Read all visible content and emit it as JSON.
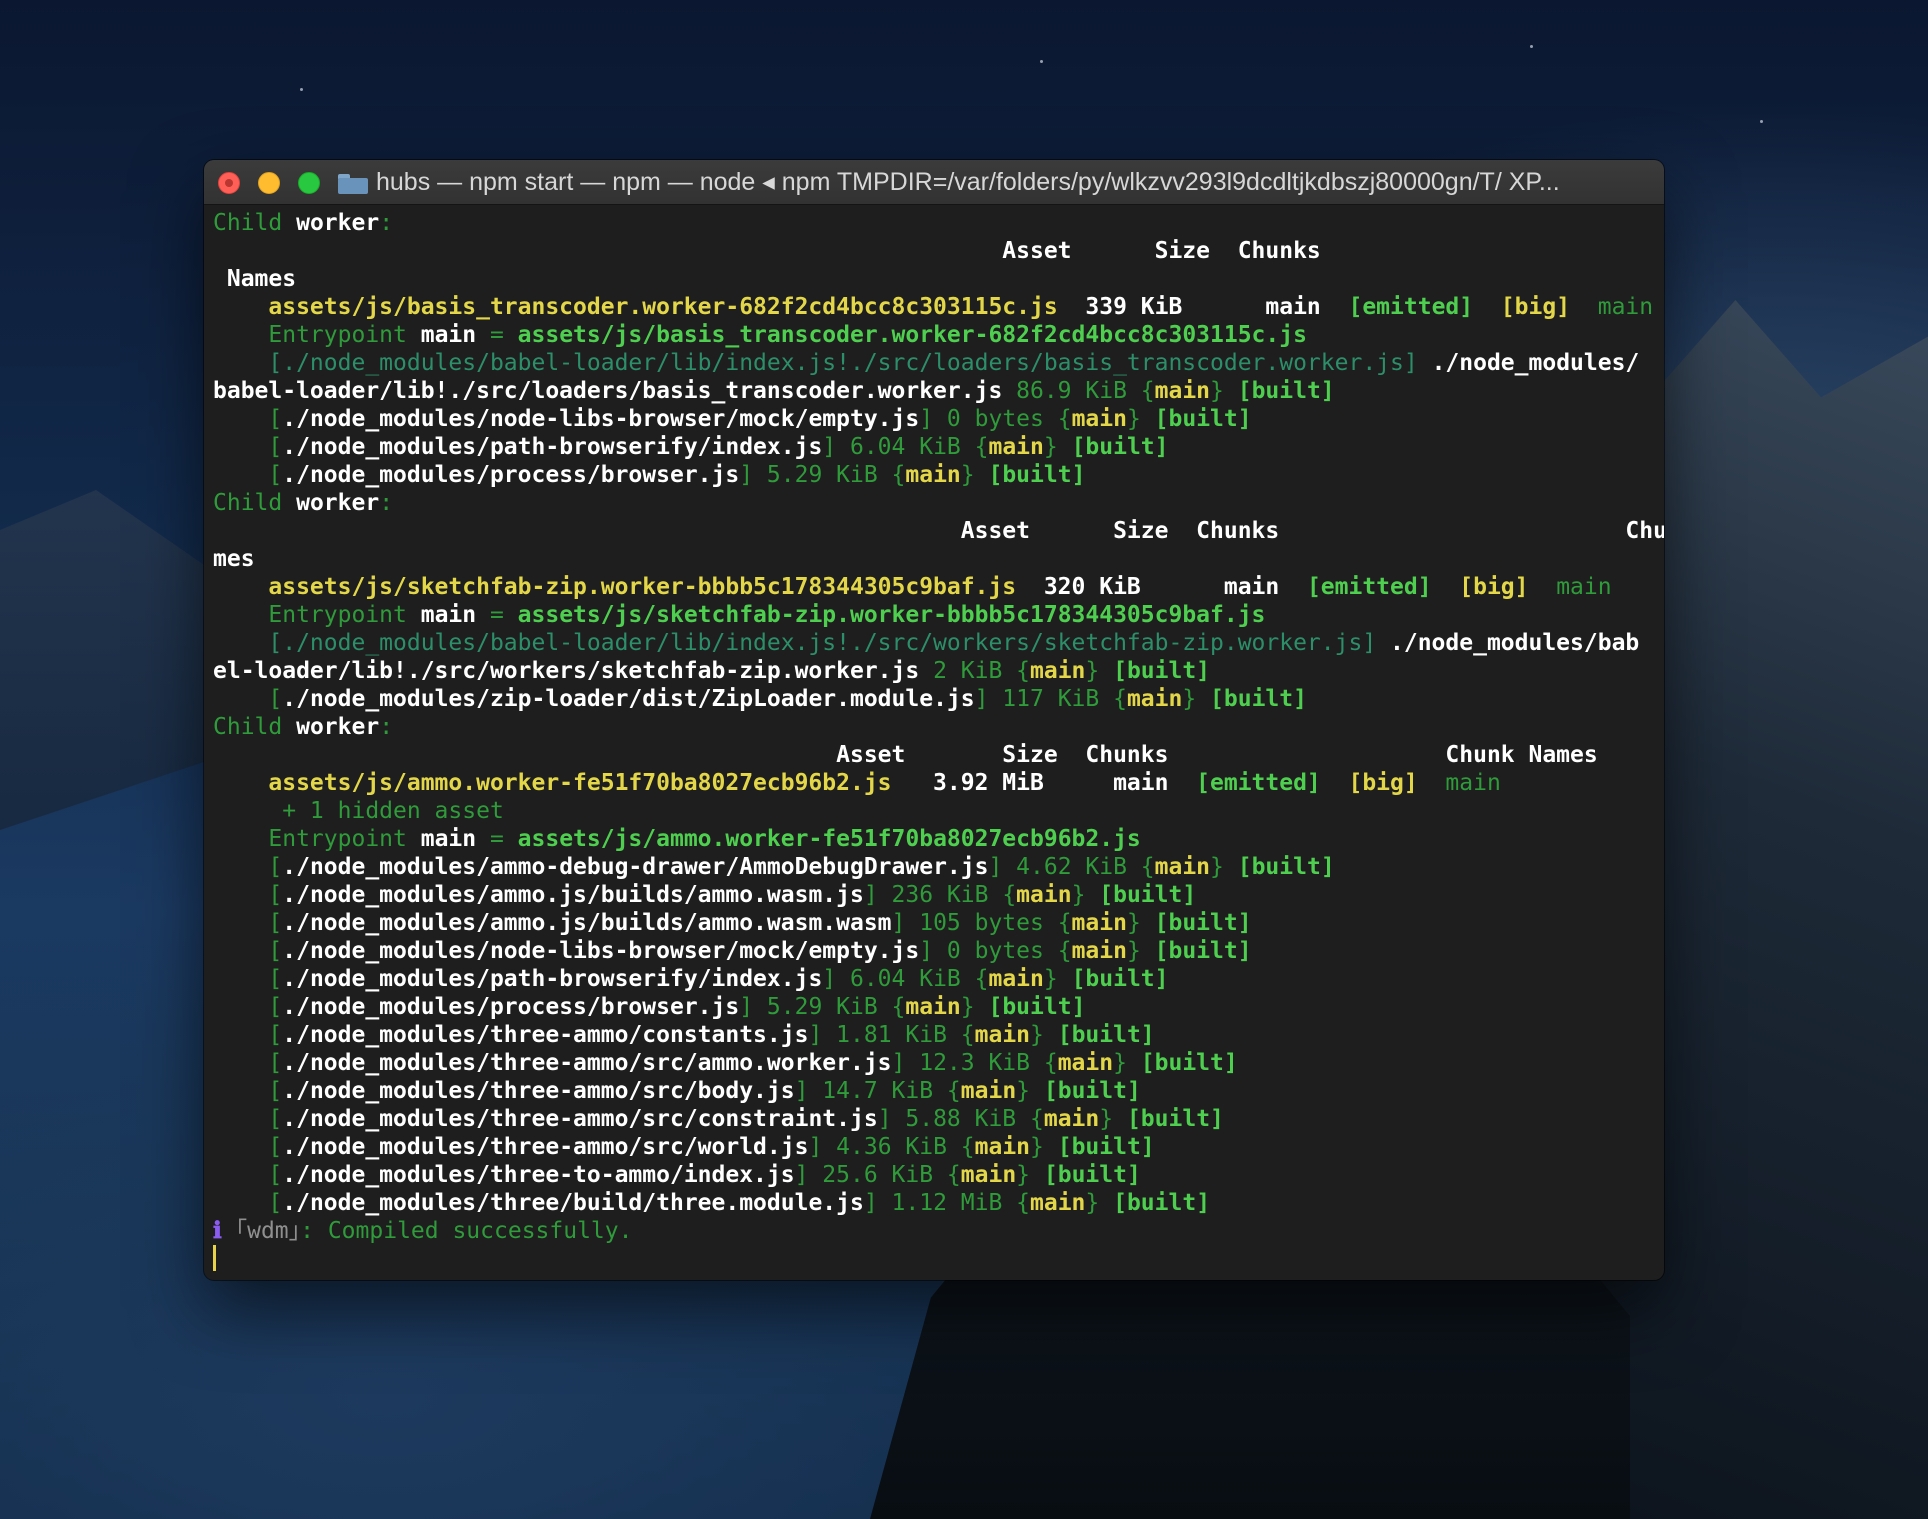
{
  "window": {
    "title": "hubs — npm start — npm — node ◂ npm TMPDIR=/var/folders/py/wlkzvv293l9dcdltjkdbszj80000gn/T/ XP..."
  },
  "terminal": {
    "lines": [
      [
        [
          "dg",
          "Child "
        ],
        [
          "w",
          "worker"
        ],
        [
          "dg",
          ":"
        ]
      ],
      [
        [
          "w",
          "                                                         Asset      Size  Chunks                         Chunk"
        ]
      ],
      [
        [
          "w",
          " Names"
        ]
      ],
      [
        [
          "y",
          "    assets/js/basis_transcoder.worker-682f2cd4bcc8c303115c.js"
        ],
        [
          "w",
          "  339 KiB      main  "
        ],
        [
          "g",
          "[emitted]"
        ],
        [
          "y",
          "  [big]"
        ],
        [
          "dg",
          "  main"
        ]
      ],
      [
        [
          "dg",
          "    Entrypoint "
        ],
        [
          "w",
          "main"
        ],
        [
          "dg",
          " = "
        ],
        [
          "g",
          "assets/js/basis_transcoder.worker-682f2cd4bcc8c303115c.js"
        ]
      ],
      [
        [
          "mg",
          "    [./node_modules/babel-loader/lib/index.js!./src/loaders/basis_transcoder.worker.js]"
        ],
        [
          "w",
          " ./node_modules/"
        ]
      ],
      [
        [
          "w",
          "babel-loader/lib!./src/loaders/basis_transcoder.worker.js"
        ],
        [
          "dg",
          " 86.9 KiB {"
        ],
        [
          "y",
          "main"
        ],
        [
          "dg",
          "} "
        ],
        [
          "g",
          "[built]"
        ]
      ],
      [
        [
          "dg",
          "    ["
        ],
        [
          "w",
          "./node_modules/node-libs-browser/mock/empty.js"
        ],
        [
          "dg",
          "] 0 bytes {"
        ],
        [
          "y",
          "main"
        ],
        [
          "dg",
          "} "
        ],
        [
          "g",
          "[built]"
        ]
      ],
      [
        [
          "dg",
          "    ["
        ],
        [
          "w",
          "./node_modules/path-browserify/index.js"
        ],
        [
          "dg",
          "] 6.04 KiB {"
        ],
        [
          "y",
          "main"
        ],
        [
          "dg",
          "} "
        ],
        [
          "g",
          "[built]"
        ]
      ],
      [
        [
          "dg",
          "    ["
        ],
        [
          "w",
          "./node_modules/process/browser.js"
        ],
        [
          "dg",
          "] 5.29 KiB {"
        ],
        [
          "y",
          "main"
        ],
        [
          "dg",
          "} "
        ],
        [
          "g",
          "[built]"
        ]
      ],
      [
        [
          "dg",
          "Child "
        ],
        [
          "w",
          "worker"
        ],
        [
          "dg",
          ":"
        ]
      ],
      [
        [
          "w",
          "                                                      Asset      Size  Chunks                         Chunk Na"
        ]
      ],
      [
        [
          "w",
          "mes"
        ]
      ],
      [
        [
          "y",
          "    assets/js/sketchfab-zip.worker-bbbb5c178344305c9baf.js"
        ],
        [
          "w",
          "  320 KiB      main  "
        ],
        [
          "g",
          "[emitted]"
        ],
        [
          "y",
          "  [big]"
        ],
        [
          "dg",
          "  main"
        ]
      ],
      [
        [
          "dg",
          "    Entrypoint "
        ],
        [
          "w",
          "main"
        ],
        [
          "dg",
          " = "
        ],
        [
          "g",
          "assets/js/sketchfab-zip.worker-bbbb5c178344305c9baf.js"
        ]
      ],
      [
        [
          "mg",
          "    [./node_modules/babel-loader/lib/index.js!./src/workers/sketchfab-zip.worker.js]"
        ],
        [
          "w",
          " ./node_modules/bab"
        ]
      ],
      [
        [
          "w",
          "el-loader/lib!./src/workers/sketchfab-zip.worker.js"
        ],
        [
          "dg",
          " 2 KiB {"
        ],
        [
          "y",
          "main"
        ],
        [
          "dg",
          "} "
        ],
        [
          "g",
          "[built]"
        ]
      ],
      [
        [
          "dg",
          "    ["
        ],
        [
          "w",
          "./node_modules/zip-loader/dist/ZipLoader.module.js"
        ],
        [
          "dg",
          "] 117 KiB {"
        ],
        [
          "y",
          "main"
        ],
        [
          "dg",
          "} "
        ],
        [
          "g",
          "[built]"
        ]
      ],
      [
        [
          "dg",
          "Child "
        ],
        [
          "w",
          "worker"
        ],
        [
          "dg",
          ":"
        ]
      ],
      [
        [
          "w",
          "                                             Asset       Size  Chunks                    Chunk Names"
        ]
      ],
      [
        [
          "y",
          "    assets/js/ammo.worker-fe51f70ba8027ecb96b2.js"
        ],
        [
          "w",
          "   3.92 MiB     main  "
        ],
        [
          "g",
          "[emitted]"
        ],
        [
          "y",
          "  [big]"
        ],
        [
          "dg",
          "  main"
        ]
      ],
      [
        [
          "dg",
          "     + 1 hidden asset"
        ]
      ],
      [
        [
          "dg",
          "    Entrypoint "
        ],
        [
          "w",
          "main"
        ],
        [
          "dg",
          " = "
        ],
        [
          "g",
          "assets/js/ammo.worker-fe51f70ba8027ecb96b2.js"
        ]
      ],
      [
        [
          "dg",
          "    ["
        ],
        [
          "w",
          "./node_modules/ammo-debug-drawer/AmmoDebugDrawer.js"
        ],
        [
          "dg",
          "] 4.62 KiB {"
        ],
        [
          "y",
          "main"
        ],
        [
          "dg",
          "} "
        ],
        [
          "g",
          "[built]"
        ]
      ],
      [
        [
          "dg",
          "    ["
        ],
        [
          "w",
          "./node_modules/ammo.js/builds/ammo.wasm.js"
        ],
        [
          "dg",
          "] 236 KiB {"
        ],
        [
          "y",
          "main"
        ],
        [
          "dg",
          "} "
        ],
        [
          "g",
          "[built]"
        ]
      ],
      [
        [
          "dg",
          "    ["
        ],
        [
          "w",
          "./node_modules/ammo.js/builds/ammo.wasm.wasm"
        ],
        [
          "dg",
          "] 105 bytes {"
        ],
        [
          "y",
          "main"
        ],
        [
          "dg",
          "} "
        ],
        [
          "g",
          "[built]"
        ]
      ],
      [
        [
          "dg",
          "    ["
        ],
        [
          "w",
          "./node_modules/node-libs-browser/mock/empty.js"
        ],
        [
          "dg",
          "] 0 bytes {"
        ],
        [
          "y",
          "main"
        ],
        [
          "dg",
          "} "
        ],
        [
          "g",
          "[built]"
        ]
      ],
      [
        [
          "dg",
          "    ["
        ],
        [
          "w",
          "./node_modules/path-browserify/index.js"
        ],
        [
          "dg",
          "] 6.04 KiB {"
        ],
        [
          "y",
          "main"
        ],
        [
          "dg",
          "} "
        ],
        [
          "g",
          "[built]"
        ]
      ],
      [
        [
          "dg",
          "    ["
        ],
        [
          "w",
          "./node_modules/process/browser.js"
        ],
        [
          "dg",
          "] 5.29 KiB {"
        ],
        [
          "y",
          "main"
        ],
        [
          "dg",
          "} "
        ],
        [
          "g",
          "[built]"
        ]
      ],
      [
        [
          "dg",
          "    ["
        ],
        [
          "w",
          "./node_modules/three-ammo/constants.js"
        ],
        [
          "dg",
          "] 1.81 KiB {"
        ],
        [
          "y",
          "main"
        ],
        [
          "dg",
          "} "
        ],
        [
          "g",
          "[built]"
        ]
      ],
      [
        [
          "dg",
          "    ["
        ],
        [
          "w",
          "./node_modules/three-ammo/src/ammo.worker.js"
        ],
        [
          "dg",
          "] 12.3 KiB {"
        ],
        [
          "y",
          "main"
        ],
        [
          "dg",
          "} "
        ],
        [
          "g",
          "[built]"
        ]
      ],
      [
        [
          "dg",
          "    ["
        ],
        [
          "w",
          "./node_modules/three-ammo/src/body.js"
        ],
        [
          "dg",
          "] 14.7 KiB {"
        ],
        [
          "y",
          "main"
        ],
        [
          "dg",
          "} "
        ],
        [
          "g",
          "[built]"
        ]
      ],
      [
        [
          "dg",
          "    ["
        ],
        [
          "w",
          "./node_modules/three-ammo/src/constraint.js"
        ],
        [
          "dg",
          "] 5.88 KiB {"
        ],
        [
          "y",
          "main"
        ],
        [
          "dg",
          "} "
        ],
        [
          "g",
          "[built]"
        ]
      ],
      [
        [
          "dg",
          "    ["
        ],
        [
          "w",
          "./node_modules/three-ammo/src/world.js"
        ],
        [
          "dg",
          "] 4.36 KiB {"
        ],
        [
          "y",
          "main"
        ],
        [
          "dg",
          "} "
        ],
        [
          "g",
          "[built]"
        ]
      ],
      [
        [
          "dg",
          "    ["
        ],
        [
          "w",
          "./node_modules/three-to-ammo/index.js"
        ],
        [
          "dg",
          "] 25.6 KiB {"
        ],
        [
          "y",
          "main"
        ],
        [
          "dg",
          "} "
        ],
        [
          "g",
          "[built]"
        ]
      ],
      [
        [
          "dg",
          "    ["
        ],
        [
          "w",
          "./node_modules/three/build/three.module.js"
        ],
        [
          "dg",
          "] 1.12 MiB {"
        ],
        [
          "y",
          "main"
        ],
        [
          "dg",
          "} "
        ],
        [
          "g",
          "[built]"
        ]
      ],
      [
        [
          "pu",
          "ℹ"
        ],
        [
          "gy",
          " ｢wdm｣"
        ],
        [
          "dg",
          ": Compiled successfully."
        ]
      ]
    ]
  },
  "colors": {
    "white": "#ffffff",
    "yellow": "#e3d749",
    "green": "#4fcf4f",
    "dim_green": "#2f9b3a",
    "teal": "#2c8f6a",
    "gray": "#8f8f8f",
    "purple": "#8a5cf0",
    "cursor": "#e8d24a"
  }
}
